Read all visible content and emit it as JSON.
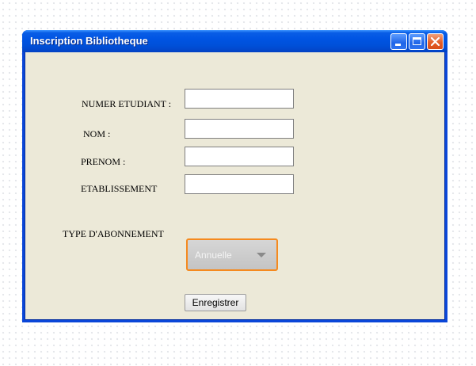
{
  "window": {
    "title": "Inscription Bibliotheque",
    "controls": {
      "minimize_icon": "minimize-icon",
      "maximize_icon": "maximize-icon",
      "close_icon": "close-icon"
    }
  },
  "form": {
    "fields": [
      {
        "label": "NUMER ETUDIANT :",
        "value": "",
        "placeholder": ""
      },
      {
        "label": "NOM :",
        "value": "",
        "placeholder": ""
      },
      {
        "label": "PRENOM :",
        "value": "",
        "placeholder": ""
      },
      {
        "label": "ETABLISSEMENT",
        "value": "",
        "placeholder": ""
      }
    ],
    "subscription": {
      "label": "TYPE D'ABONNEMENT",
      "selected": "Annuelle"
    },
    "submit_label": "Enregistrer"
  },
  "colors": {
    "title_bar": "#0054e3",
    "window_bg": "#ece9d8",
    "combo_focus_border": "#f58a1f",
    "close_button": "#e35d28"
  }
}
